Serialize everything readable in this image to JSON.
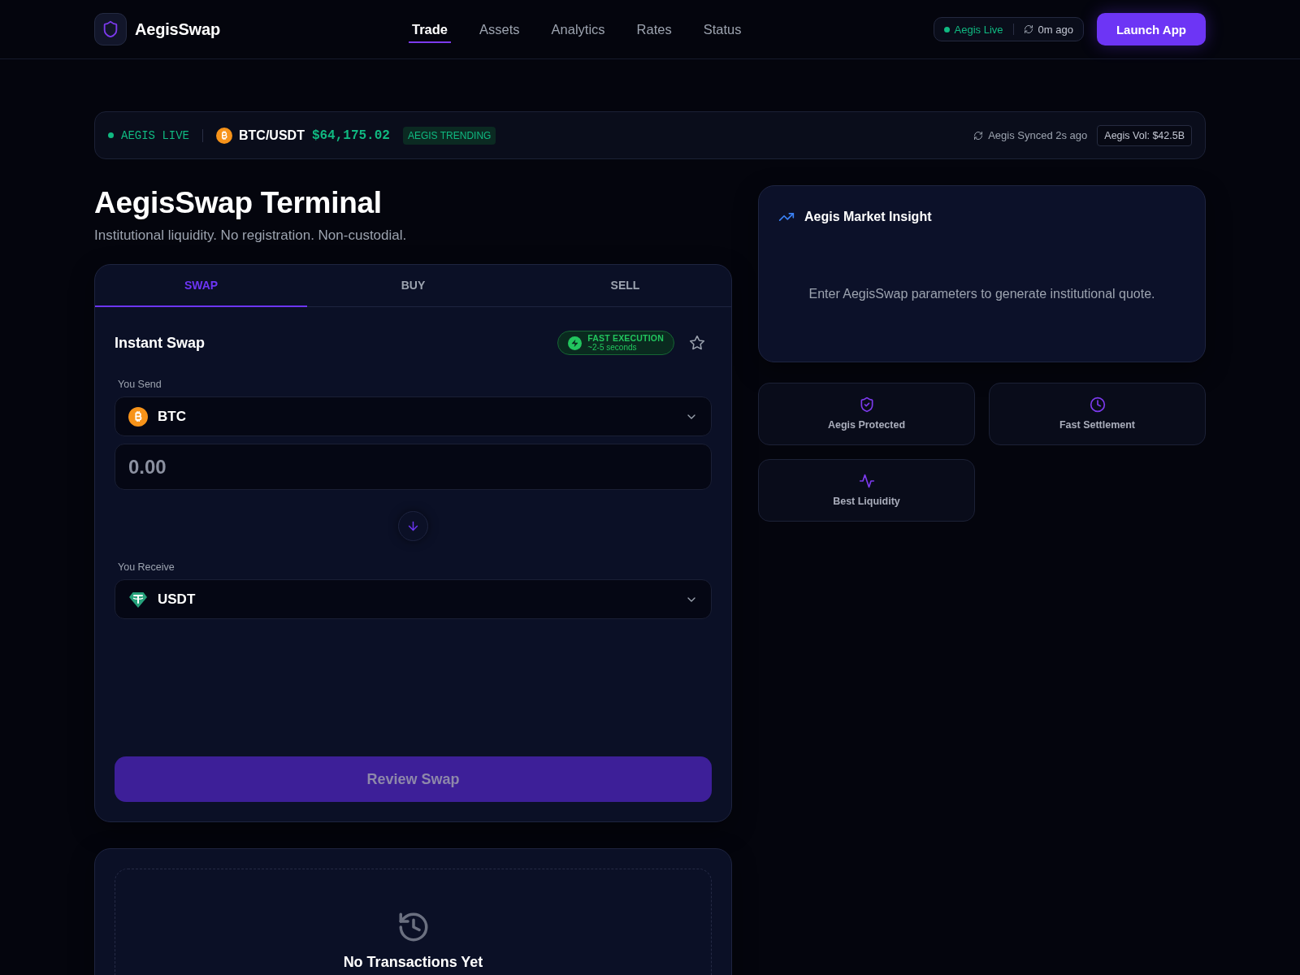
{
  "header": {
    "brand": "AegisSwap",
    "nav": [
      {
        "label": "Trade",
        "selected": true
      },
      {
        "label": "Assets",
        "selected": false
      },
      {
        "label": "Analytics",
        "selected": false
      },
      {
        "label": "Rates",
        "selected": false
      },
      {
        "label": "Status",
        "selected": false
      }
    ],
    "status": {
      "live": "Aegis Live",
      "updated": "0m ago"
    },
    "cta": "Launch App"
  },
  "ticker": {
    "live": "AEGIS LIVE",
    "pair": "BTC/USDT",
    "price": "$64,175.02",
    "badge": "AEGIS TRENDING",
    "synced": "Aegis Synced 2s ago",
    "volume": "Aegis Vol: $42.5B"
  },
  "page": {
    "title": "AegisSwap Terminal",
    "subtitle": "Institutional liquidity. No registration. Non-custodial."
  },
  "trade": {
    "tabs": [
      {
        "label": "SWAP",
        "selected": true
      },
      {
        "label": "BUY",
        "selected": false
      },
      {
        "label": "SELL",
        "selected": false
      }
    ],
    "title": "Instant Swap",
    "speed": {
      "label": "FAST EXECUTION",
      "detail": "~2-5 seconds"
    },
    "starred": false,
    "send": {
      "label": "You Send",
      "asset": "BTC",
      "placeholder": "0.00"
    },
    "receive": {
      "label": "You Receive",
      "asset": "USDT"
    },
    "submit": {
      "label": "Review Swap",
      "disabled": true
    }
  },
  "history": {
    "title": "No Transactions Yet"
  },
  "insight": {
    "title": "Aegis Market Insight",
    "message": "Enter AegisSwap parameters to generate institutional quote."
  },
  "features": [
    {
      "label": "Aegis Protected"
    },
    {
      "label": "Fast Settlement"
    },
    {
      "label": "Best Liquidity"
    }
  ]
}
